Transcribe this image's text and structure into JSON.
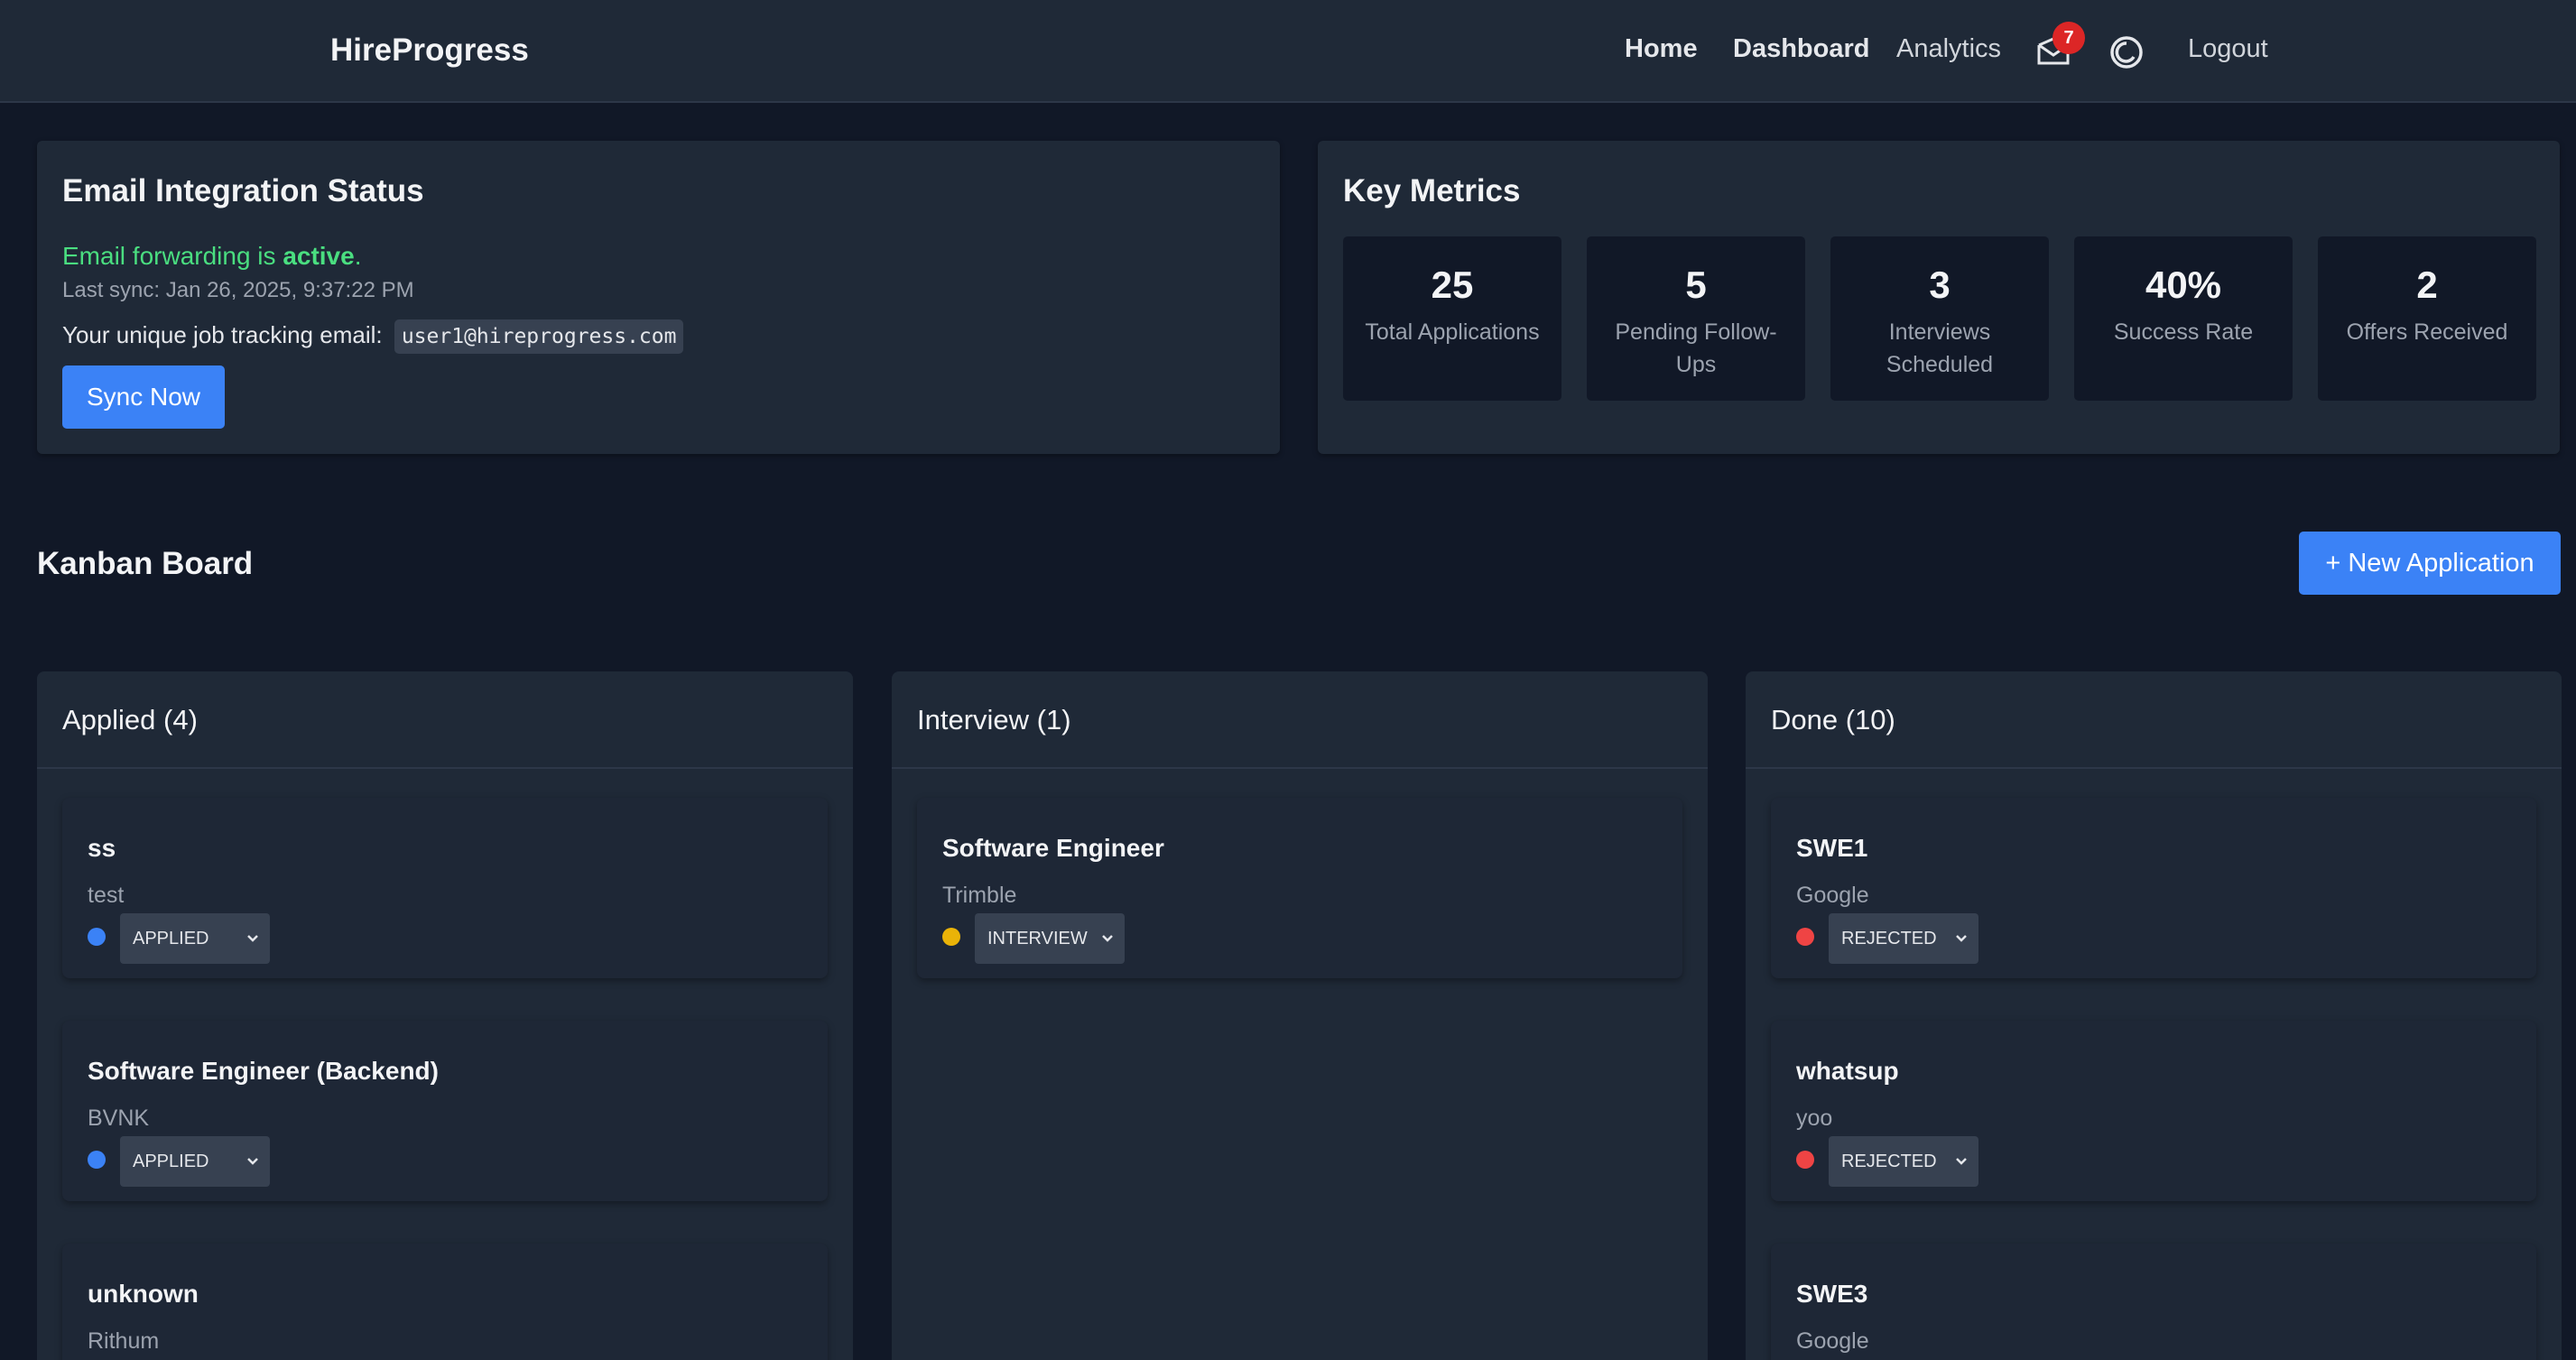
{
  "nav": {
    "brand": "HireProgress",
    "links": {
      "home": "Home",
      "dashboard": "Dashboard",
      "analytics": "Analytics",
      "logout": "Logout"
    },
    "mail_badge": "7",
    "mail_icon": "mail-icon",
    "theme_icon": "theme-toggle-icon"
  },
  "email_status": {
    "title": "Email Integration Status",
    "forwarding_prefix": "Email forwarding is ",
    "forwarding_state": "active",
    "forwarding_suffix": ".",
    "last_sync": "Last sync: Jan 26, 2025, 9:37:22 PM",
    "email_label": "Your unique job tracking email:",
    "email_address": "user1@hireprogress.com",
    "sync_button": "Sync Now"
  },
  "metrics": {
    "title": "Key Metrics",
    "items": [
      {
        "value": "25",
        "label": "Total Applications"
      },
      {
        "value": "5",
        "label": "Pending Follow-Ups"
      },
      {
        "value": "3",
        "label": "Interviews Scheduled"
      },
      {
        "value": "40%",
        "label": "Success Rate"
      },
      {
        "value": "2",
        "label": "Offers Received"
      }
    ]
  },
  "kanban": {
    "title": "Kanban Board",
    "new_button": "+ New Application",
    "columns": [
      {
        "title": "Applied (4)",
        "cards": [
          {
            "title": "ss",
            "company": "test",
            "status": "APPLIED",
            "color": "#3b82f6"
          },
          {
            "title": "Software Engineer (Backend)",
            "company": "BVNK",
            "status": "APPLIED",
            "color": "#3b82f6"
          },
          {
            "title": "unknown",
            "company": "Rithum"
          }
        ]
      },
      {
        "title": "Interview (1)",
        "cards": [
          {
            "title": "Software Engineer",
            "company": "Trimble",
            "status": "INTERVIEW",
            "color": "#eab308"
          }
        ]
      },
      {
        "title": "Done (10)",
        "cards": [
          {
            "title": "SWE1",
            "company": "Google",
            "status": "REJECTED",
            "color": "#ef4444"
          },
          {
            "title": "whatsup",
            "company": "yoo",
            "status": "REJECTED",
            "color": "#ef4444"
          },
          {
            "title": "SWE3",
            "company": "Google"
          }
        ]
      }
    ]
  }
}
